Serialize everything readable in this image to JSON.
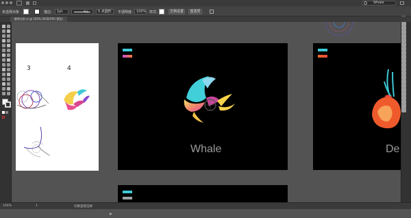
{
  "menubar": {
    "app_user": "Whale"
  },
  "controlbar": {
    "selection_label": "未选择对象",
    "stroke_label": "描边:",
    "stroke_value": "1pt",
    "dash_label": "等比",
    "brush_label": "5 点圆形",
    "opacity_label": "不透明度:",
    "opacity_value": "100%",
    "style_label": "样式:",
    "doc_setup_button": "文档设置",
    "prefs_button": "首选项"
  },
  "tabs": [
    {
      "label": "鲸鱼分析.ai @ 100% (RGB/GPU 预览)"
    }
  ],
  "artboards": {
    "left": {
      "label_3": "3",
      "label_4": "4"
    },
    "whale": {
      "caption": "Whale"
    },
    "right": {
      "caption": "De"
    }
  },
  "colors": {
    "teal": "#3ec9d6",
    "magenta": "#c752c9",
    "orange": "#ef6a2c",
    "red": "#e8483a",
    "gray_chip": "#9aa4a8"
  },
  "statusbar": {
    "zoom": "100%",
    "page": "1",
    "tool_name": "切换直接选择"
  }
}
